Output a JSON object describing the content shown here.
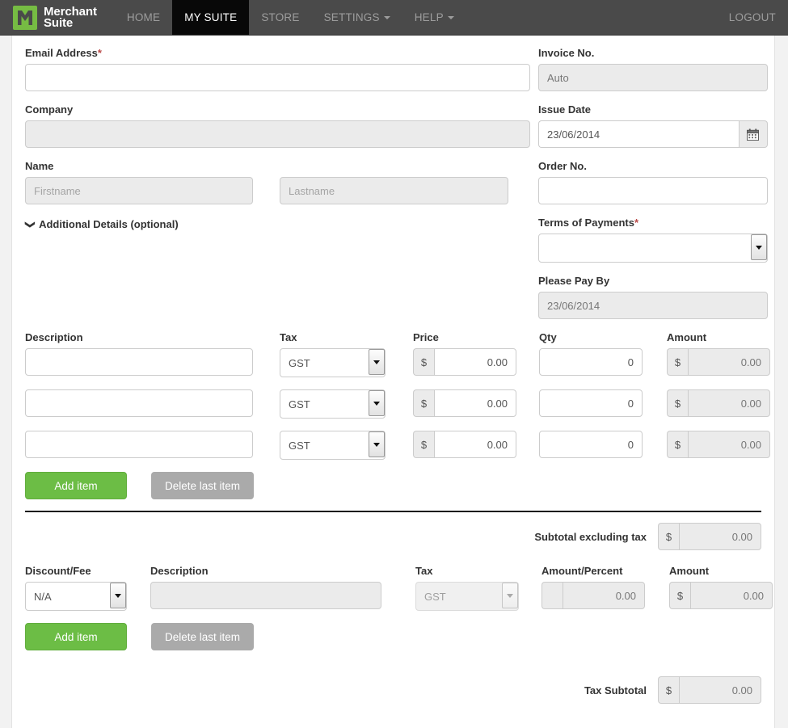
{
  "navbar": {
    "brand": {
      "line1": "Merchant",
      "line2": "Suite",
      "logo_icon": "merchant-suite-logo-icon",
      "color": "#76bc43"
    },
    "items": [
      {
        "label": "HOME",
        "active": false,
        "caret": false
      },
      {
        "label": "MY SUITE",
        "active": true,
        "caret": false
      },
      {
        "label": "STORE",
        "active": false,
        "caret": false
      },
      {
        "label": "SETTINGS",
        "active": false,
        "caret": true
      },
      {
        "label": "HELP",
        "active": false,
        "caret": true
      }
    ],
    "logout_label": "LOGOUT",
    "background": "#4a4a4a",
    "active_background": "#080808"
  },
  "form": {
    "email": {
      "label": "Email Address",
      "required": true,
      "value": "",
      "placeholder": ""
    },
    "company": {
      "label": "Company",
      "value": "",
      "placeholder": "",
      "disabled": true
    },
    "name": {
      "label": "Name",
      "first": {
        "value": "",
        "placeholder": "Firstname",
        "disabled": true
      },
      "last": {
        "value": "",
        "placeholder": "Lastname",
        "disabled": true
      }
    },
    "additional_details": {
      "label": "Additional Details (optional)",
      "chevron": "chevron-down-icon"
    },
    "invoice_no": {
      "label": "Invoice No.",
      "value": "Auto",
      "disabled": true
    },
    "issue_date": {
      "label": "Issue Date",
      "value": "23/06/2014",
      "button_icon": "calendar-icon"
    },
    "order_no": {
      "label": "Order No.",
      "value": "",
      "placeholder": ""
    },
    "terms_of_payments": {
      "label": "Terms of Payments",
      "required": true,
      "value": "",
      "options": [
        ""
      ]
    },
    "please_pay_by": {
      "label": "Please Pay By",
      "value": "23/06/2014",
      "disabled": true
    }
  },
  "items_table": {
    "headers": {
      "description": "Description",
      "tax": "Tax",
      "price": "Price",
      "qty": "Qty",
      "amount": "Amount"
    },
    "currency_symbol": "$",
    "tax_options": [
      "GST"
    ],
    "rows": [
      {
        "description": "",
        "tax": "GST",
        "price": "0.00",
        "qty": "0",
        "amount": "0.00"
      },
      {
        "description": "",
        "tax": "GST",
        "price": "0.00",
        "qty": "0",
        "amount": "0.00"
      },
      {
        "description": "",
        "tax": "GST",
        "price": "0.00",
        "qty": "0",
        "amount": "0.00"
      }
    ],
    "add_item_label": "Add item",
    "delete_last_item_label": "Delete last item"
  },
  "subtotal": {
    "label": "Subtotal excluding tax",
    "currency_symbol": "$",
    "value": "0.00"
  },
  "discount_section": {
    "headers": {
      "type": "Discount/Fee",
      "description": "Description",
      "tax": "Tax",
      "amount_percent": "Amount/Percent",
      "amount": "Amount"
    },
    "type_value": "N/A",
    "type_options": [
      "N/A"
    ],
    "description_value": "",
    "tax_value": "GST",
    "tax_options": [
      "GST"
    ],
    "amount_percent_value": "0.00",
    "currency_symbol": "$",
    "amount_value": "0.00",
    "add_item_label": "Add item",
    "delete_last_item_label": "Delete last item"
  },
  "tax_subtotal": {
    "label": "Tax Subtotal",
    "currency_symbol": "$",
    "value": "0.00"
  },
  "theme": {
    "green": "#6cbd45",
    "grey_button": "#aaaaaa",
    "required_star": "#b94a48",
    "disabled_bg": "#ebebeb"
  }
}
